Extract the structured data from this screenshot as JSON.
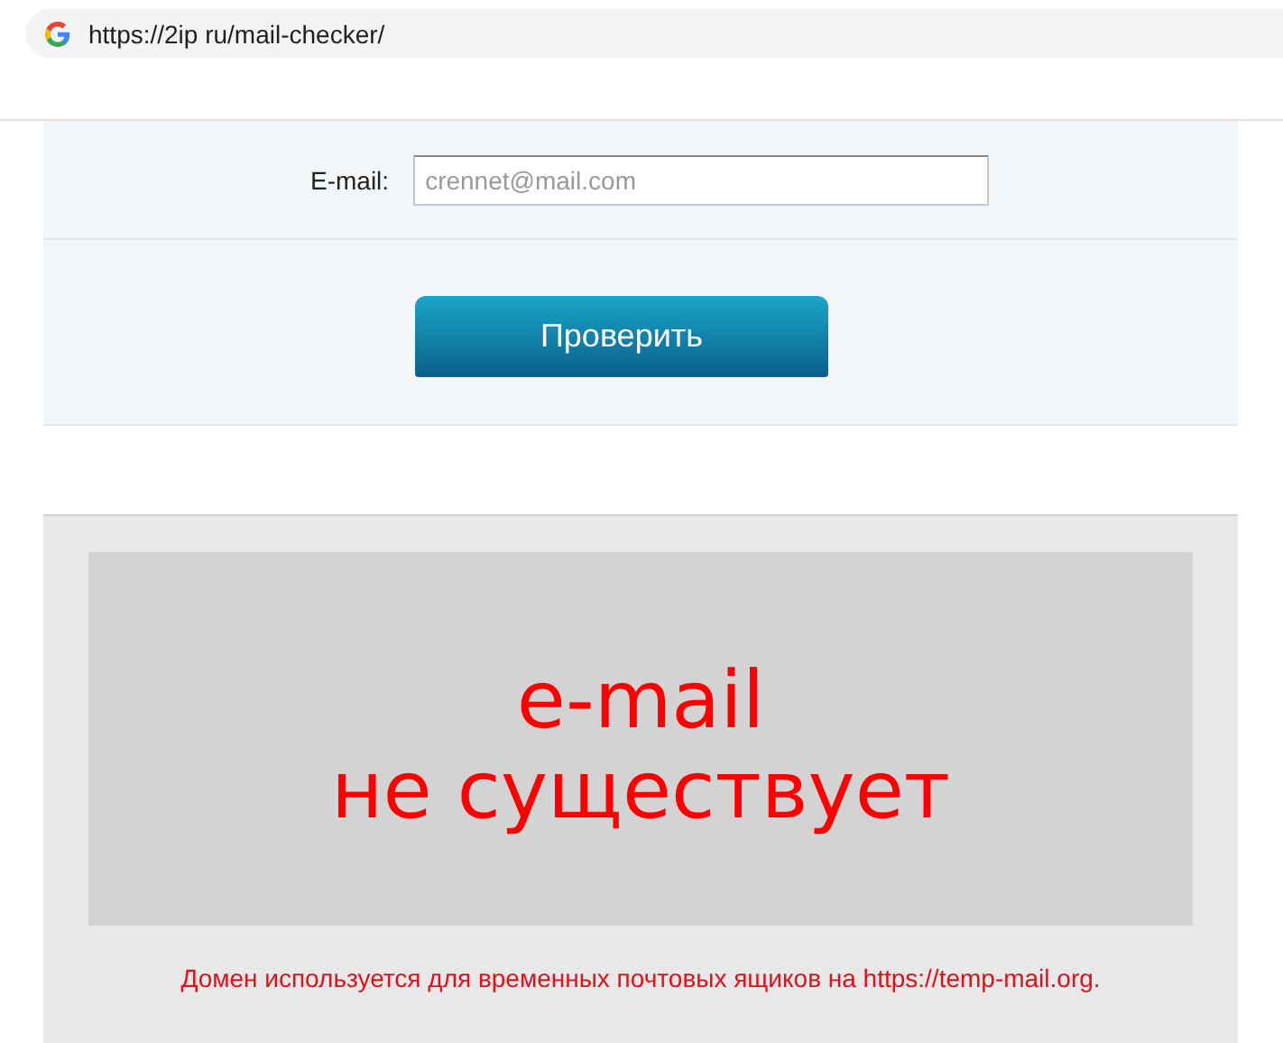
{
  "browser": {
    "url": "https://2ip ru/mail-checker/"
  },
  "form": {
    "email_label": "E-mail:",
    "email_field": {
      "placeholder": "crennet@mail.com"
    },
    "submit_button": "Проверить"
  },
  "result": {
    "headline_lines": [
      "e-mail",
      "не существует"
    ],
    "note": "Домен используется для временных почтовых ящиков на https://temp-mail.org."
  }
}
